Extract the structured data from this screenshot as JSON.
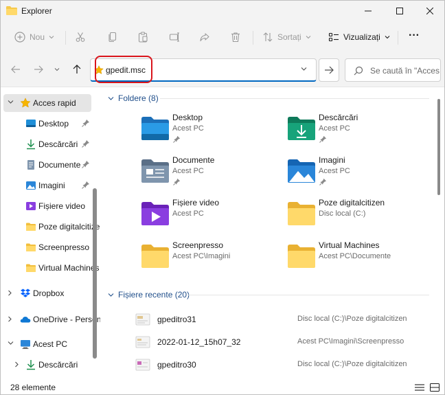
{
  "window": {
    "title": "Explorer",
    "controls": {
      "minimize_icon": "minimize-icon",
      "maximize_icon": "maximize-icon",
      "close_icon": "close-icon"
    }
  },
  "commandbar": {
    "new_label": "Nou",
    "sort_label": "Sortați",
    "view_label": "Vizualizați",
    "more_label": "···"
  },
  "navigation": {
    "address_value": "gpedit.msc",
    "search_placeholder": "Se caută în \"Acces rapid\""
  },
  "sidebar": {
    "items": [
      {
        "label": "Acces rapid",
        "icon": "star-icon"
      },
      {
        "label": "Desktop",
        "icon": "desktop-icon",
        "pinned": true
      },
      {
        "label": "Descărcări",
        "icon": "download-icon",
        "pinned": true
      },
      {
        "label": "Documente",
        "icon": "document-icon",
        "pinned": true
      },
      {
        "label": "Imagini",
        "icon": "image-icon",
        "pinned": true
      },
      {
        "label": "Fișiere video",
        "icon": "video-icon",
        "pinned": false
      },
      {
        "label": "Poze digitalcitizen",
        "icon": "folder-icon",
        "pinned": false
      },
      {
        "label": "Screenpresso",
        "icon": "folder-icon",
        "pinned": false
      },
      {
        "label": "Virtual Machines",
        "icon": "folder-icon",
        "pinned": false
      },
      {
        "label": "Dropbox",
        "icon": "dropbox-icon"
      },
      {
        "label": "OneDrive - Personal",
        "icon": "onedrive-icon"
      },
      {
        "label": "Acest PC",
        "icon": "pc-icon"
      },
      {
        "label": "Descărcări",
        "icon": "download-icon"
      }
    ]
  },
  "main": {
    "folders_header": "Foldere (8)",
    "folders": [
      {
        "name": "Desktop",
        "location": "Acest PC",
        "pinned": true,
        "icon": "desktop-folder-icon"
      },
      {
        "name": "Descărcări",
        "location": "Acest PC",
        "pinned": true,
        "icon": "downloads-folder-icon"
      },
      {
        "name": "Documente",
        "location": "Acest PC",
        "pinned": true,
        "icon": "documents-folder-icon"
      },
      {
        "name": "Imagini",
        "location": "Acest PC",
        "pinned": true,
        "icon": "pictures-folder-icon"
      },
      {
        "name": "Fișiere video",
        "location": "Acest PC",
        "pinned": false,
        "icon": "videos-folder-icon"
      },
      {
        "name": "Poze digitalcitizen",
        "location": "Disc local (C:)",
        "pinned": false,
        "icon": "folder-icon"
      },
      {
        "name": "Screenpresso",
        "location": "Acest PC\\Imagini",
        "pinned": false,
        "icon": "folder-icon"
      },
      {
        "name": "Virtual Machines",
        "location": "Acest PC\\Documente",
        "pinned": false,
        "icon": "folder-icon"
      }
    ],
    "recent_header": "Fișiere recente (20)",
    "recent_files": [
      {
        "name": "gpeditro31",
        "location": "Disc local (C:)\\Poze digitalcitizen"
      },
      {
        "name": "2022-01-12_15h07_32",
        "location": "Acest PC\\Imagini\\Screenpresso"
      },
      {
        "name": "gpeditro30",
        "location": "Disc local (C:)\\Poze digitalcitizen"
      }
    ]
  },
  "statusbar": {
    "item_count": "28 elemente"
  },
  "colors": {
    "accent": "#0067c0",
    "highlight": "#d9141b",
    "chrome": "#f3f3f3",
    "folder_yellow": "#f6c94b"
  }
}
